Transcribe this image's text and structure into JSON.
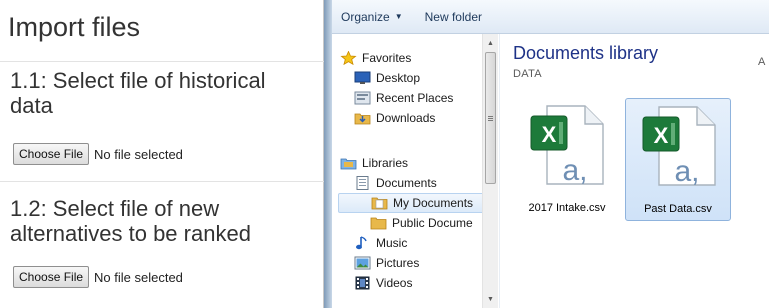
{
  "import_page": {
    "title": "Import files",
    "section1": {
      "heading": "1.1: Select file of historical data",
      "button_label": "Choose File",
      "status": "No file selected"
    },
    "section2": {
      "heading": "1.2: Select file of new alternatives to be ranked",
      "button_label": "Choose File",
      "status": "No file selected"
    }
  },
  "explorer": {
    "toolbar": {
      "organize_label": "Organize",
      "new_folder_label": "New folder"
    },
    "nav": {
      "favorites": "Favorites",
      "desktop": "Desktop",
      "recent_places": "Recent Places",
      "downloads": "Downloads",
      "libraries": "Libraries",
      "documents": "Documents",
      "my_documents": "My Documents",
      "public_documents": "Public Docume",
      "music": "Music",
      "pictures": "Pictures",
      "videos": "Videos"
    },
    "library": {
      "title": "Documents library",
      "subtitle": "DATA",
      "arrange_peek": "A"
    },
    "files": [
      {
        "name": "2017 Intake.csv",
        "icon": "excel-csv-icon",
        "selected": false
      },
      {
        "name": "Past Data.csv",
        "icon": "excel-csv-icon",
        "selected": true
      }
    ]
  },
  "colors": {
    "text_dark": "#333333",
    "library_title": "#1e3287",
    "selection_fill": "#cfe2f8",
    "selection_border": "#8fb3dd",
    "excel_green": "#1d7a3a"
  }
}
